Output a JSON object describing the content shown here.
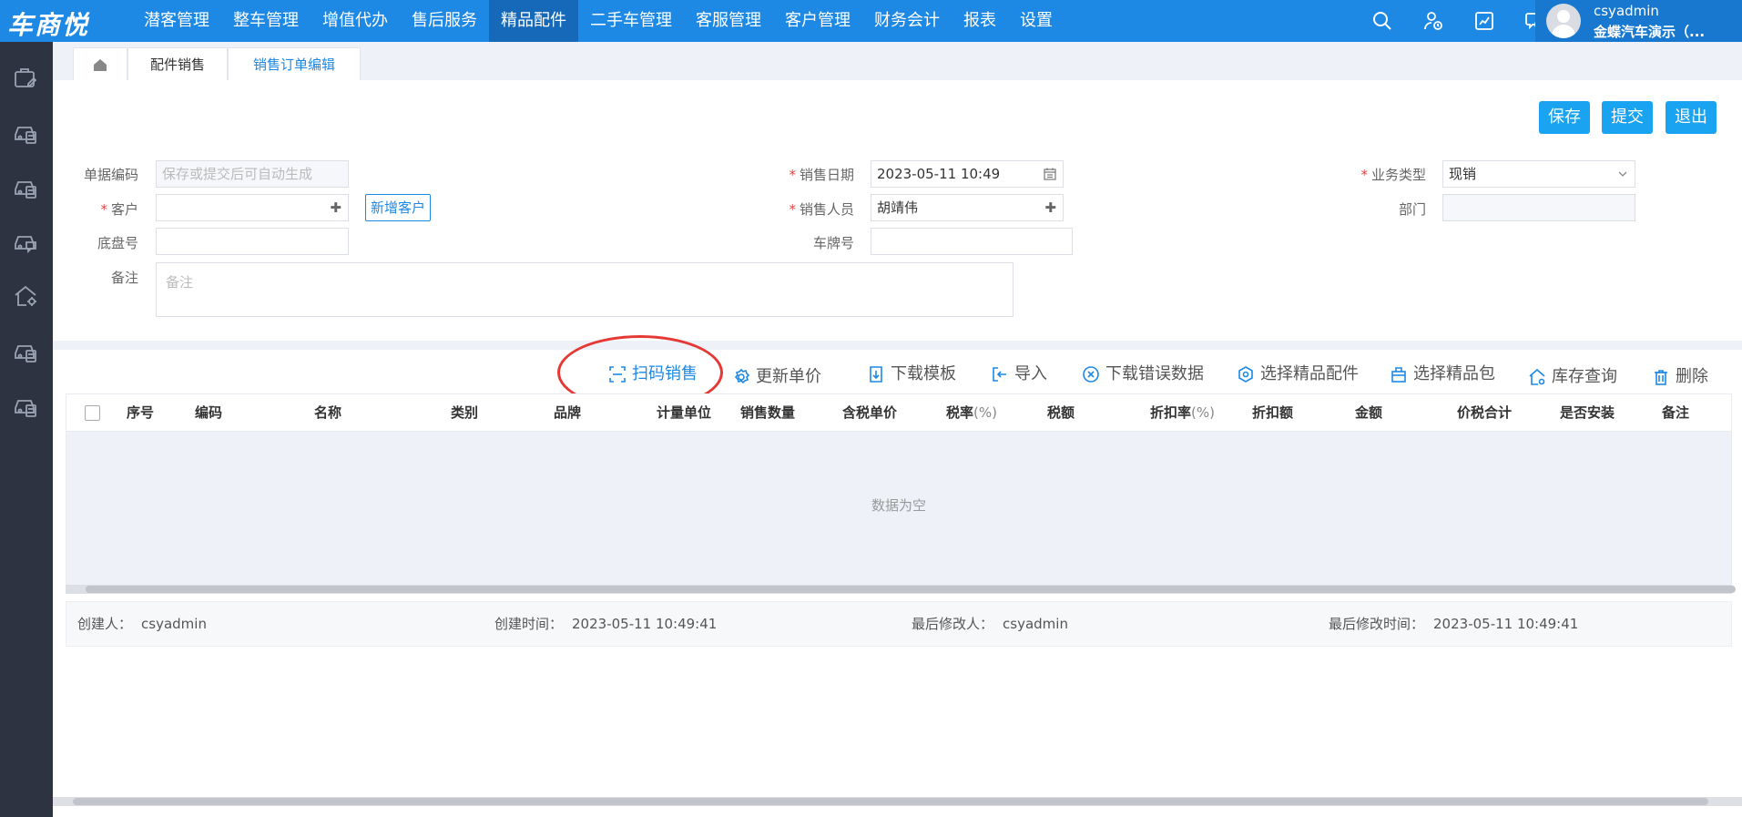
{
  "app": {
    "logo": "车商悦"
  },
  "nav": {
    "items": [
      "潜客管理",
      "整车管理",
      "增值代办",
      "售后服务",
      "精品配件",
      "二手车管理",
      "客服管理",
      "客户管理",
      "财务会计",
      "报表",
      "设置"
    ],
    "active_index": 4
  },
  "user": {
    "name": "csyadmin",
    "org": "金蝶汽车演示（..."
  },
  "tabs": {
    "tab1": "配件销售",
    "tab2": "销售订单编辑"
  },
  "actions": {
    "save": "保存",
    "submit": "提交",
    "exit": "退出"
  },
  "form": {
    "doc_code_label": "单据编码",
    "doc_code_placeholder": "保存或提交后可自动生成",
    "customer_label": "客户",
    "new_customer": "新增客户",
    "chassis_label": "底盘号",
    "remark_label": "备注",
    "remark_placeholder": "备注",
    "sale_date_label": "销售日期",
    "sale_date_value": "2023-05-11 10:49",
    "salesperson_label": "销售人员",
    "salesperson_value": "胡靖伟",
    "plate_label": "车牌号",
    "biz_type_label": "业务类型",
    "biz_type_value": "现销",
    "dept_label": "部门",
    "required_mark": "*"
  },
  "toolbar": {
    "scan_sale": "扫码销售",
    "update_price": "更新单价",
    "download_template": "下载模板",
    "import": "导入",
    "download_error": "下载错误数据",
    "select_parts": "选择精品配件",
    "select_package": "选择精品包",
    "stock_query": "库存查询",
    "delete": "删除"
  },
  "table": {
    "columns": {
      "seq": "序号",
      "code": "编码",
      "name": "名称",
      "category": "类别",
      "brand": "品牌",
      "unit": "计量单位",
      "qty": "销售数量",
      "price": "含税单价",
      "tax_rate": "税率",
      "tax_rate_unit": "(%)",
      "tax": "税额",
      "discount_rate": "折扣率",
      "discount_rate_unit": "(%)",
      "discount": "折扣额",
      "amount": "金额",
      "total": "价税合计",
      "install": "是否安装",
      "remark": "备注"
    },
    "empty": "数据为空"
  },
  "footer": {
    "creator_label": "创建人：",
    "creator": "csyadmin",
    "create_time_label": "创建时间：",
    "create_time": "2023-05-11 10:49:41",
    "modifier_label": "最后修改人：",
    "modifier": "csyadmin",
    "modify_time_label": "最后修改时间：",
    "modify_time": "2023-05-11 10:49:41"
  },
  "colors": {
    "primary": "#1e88e5",
    "sidebar": "#2d3340",
    "button": "#1aa3f0",
    "annotation": "#e53935"
  }
}
